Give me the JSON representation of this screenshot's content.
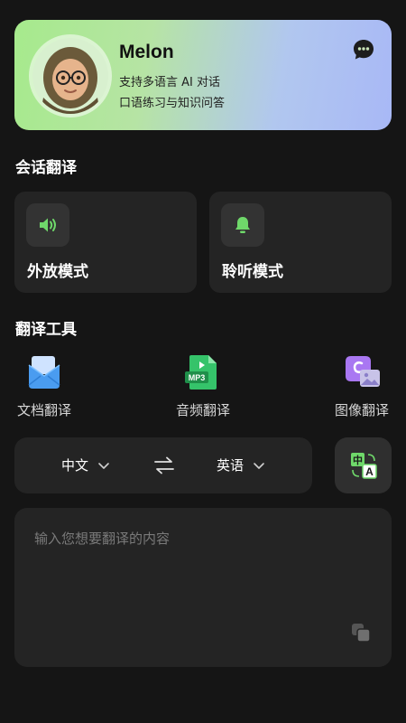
{
  "header": {
    "bot_name": "Melon",
    "line1": "支持多语言 AI 对话",
    "line2": "口语练习与知识问答"
  },
  "conversation": {
    "title": "会话翻译",
    "modes": [
      {
        "label": "外放模式",
        "icon": "speaker-icon"
      },
      {
        "label": "聆听模式",
        "icon": "bell-icon"
      }
    ]
  },
  "tools": {
    "title": "翻译工具",
    "items": [
      {
        "label": "文档翻译",
        "icon": "document-envelope-icon"
      },
      {
        "label": "音频翻译",
        "icon": "mp3-file-icon",
        "badge": "MP3"
      },
      {
        "label": "图像翻译",
        "icon": "image-translate-icon"
      }
    ]
  },
  "languages": {
    "source": "中文",
    "target": "英语",
    "translate_icon_chars": [
      "中",
      "A"
    ]
  },
  "input": {
    "placeholder": "输入您想要翻译的内容"
  },
  "colors": {
    "background": "#151515",
    "card": "#242424",
    "accent_green": "#6fd86a",
    "gradient_start": "#a6ea8c",
    "gradient_end": "#a8b8f6"
  }
}
